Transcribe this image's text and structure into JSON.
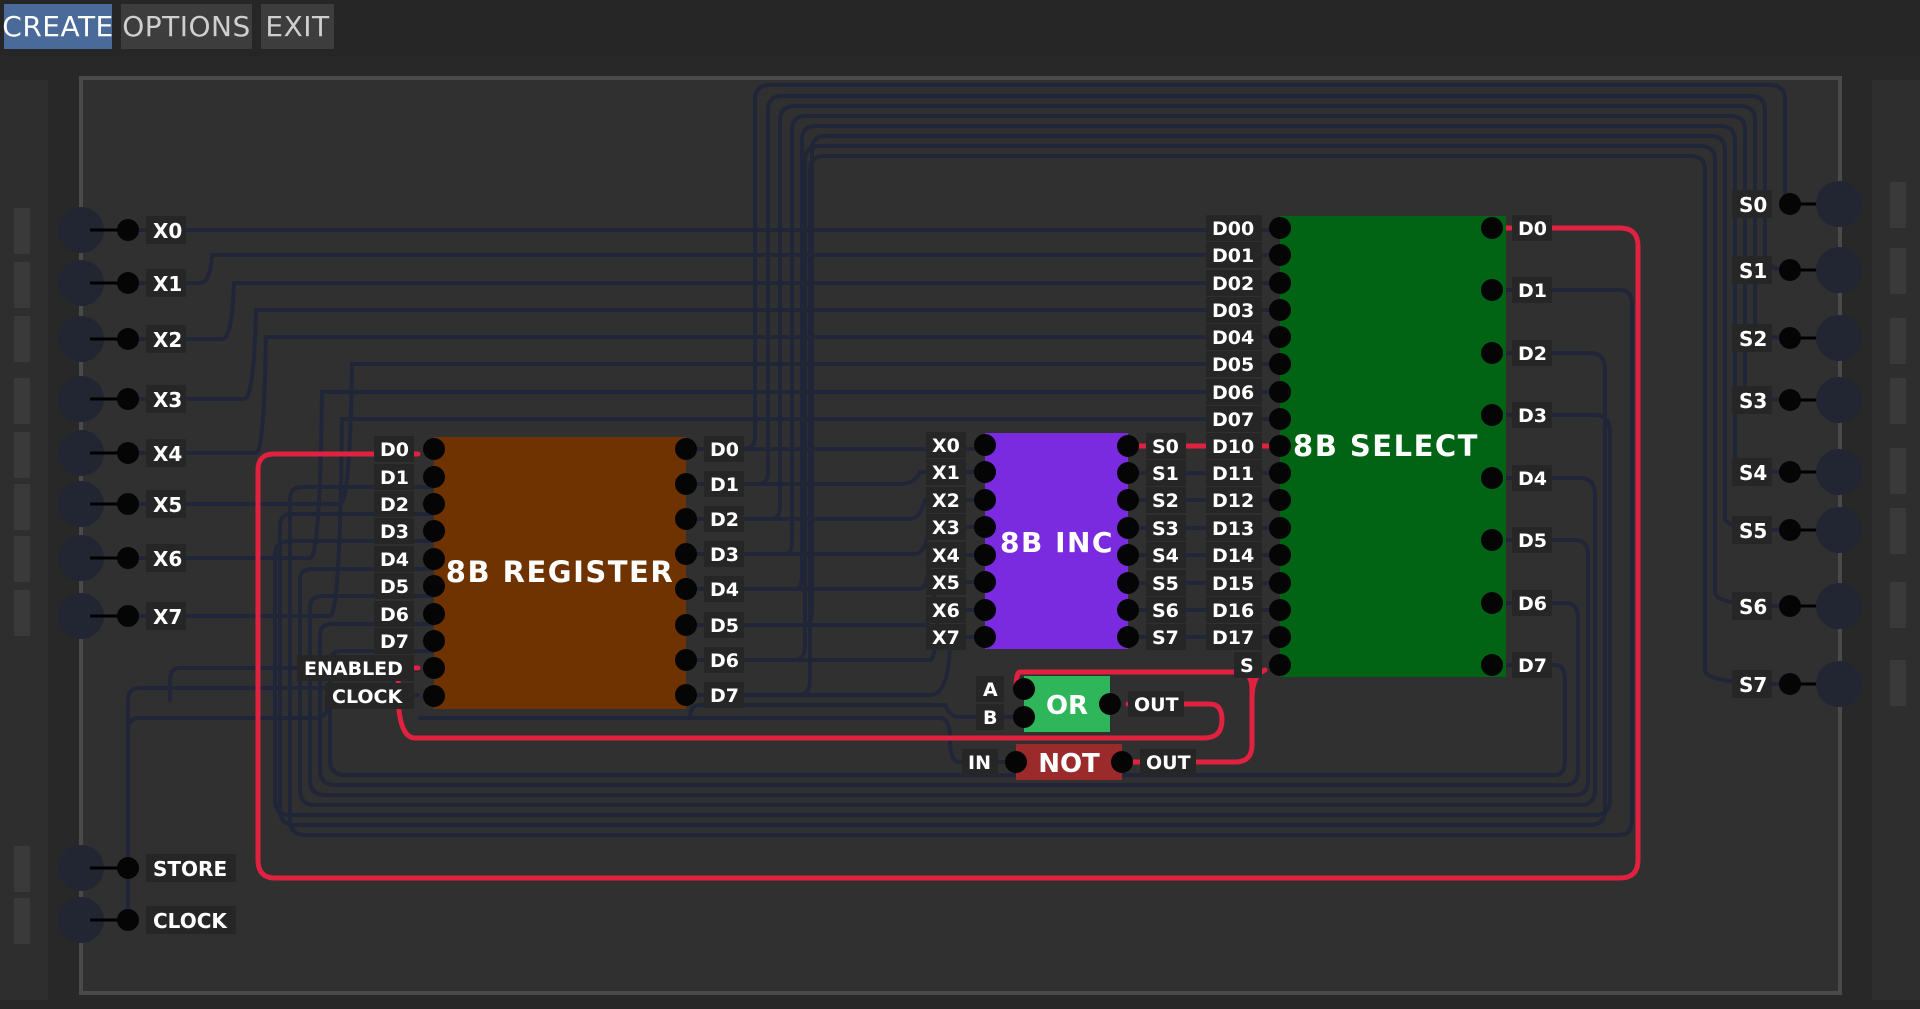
{
  "menu": {
    "create_label": "CREATE",
    "options_label": "OPTIONS",
    "exit_label": "EXIT"
  },
  "inputs": {
    "x0": "X0",
    "x1": "X1",
    "x2": "X2",
    "x3": "X3",
    "x4": "X4",
    "x5": "X5",
    "x6": "X6",
    "x7": "X7",
    "store": "STORE",
    "clock": "CLOCK"
  },
  "outputs": {
    "s0": "S0",
    "s1": "S1",
    "s2": "S2",
    "s3": "S3",
    "s4": "S4",
    "s5": "S5",
    "s6": "S6",
    "s7": "S7"
  },
  "register": {
    "title": "8B REGISTER",
    "in_pins": [
      "D0",
      "D1",
      "D2",
      "D3",
      "D4",
      "D5",
      "D6",
      "D7"
    ],
    "enabled_label": "ENABLED",
    "clock_label": "CLOCK",
    "out_pins": [
      "D0",
      "D1",
      "D2",
      "D3",
      "D4",
      "D5",
      "D6",
      "D7"
    ]
  },
  "inc": {
    "title": "8B INC",
    "in_pins": [
      "X0",
      "X1",
      "X2",
      "X3",
      "X4",
      "X5",
      "X6",
      "X7"
    ],
    "out_pins": [
      "S0",
      "S1",
      "S2",
      "S3",
      "S4",
      "S5",
      "S6",
      "S7"
    ]
  },
  "select": {
    "title": "8B SELECT",
    "in_pins": [
      "D00",
      "D01",
      "D02",
      "D03",
      "D04",
      "D05",
      "D06",
      "D07",
      "D10",
      "D11",
      "D12",
      "D13",
      "D14",
      "D15",
      "D16",
      "D17"
    ],
    "s_label": "S",
    "out_pins": [
      "D0",
      "D1",
      "D2",
      "D3",
      "D4",
      "D5",
      "D6",
      "D7"
    ]
  },
  "or_gate": {
    "title": "OR",
    "a_label": "A",
    "b_label": "B",
    "out_label": "OUT"
  },
  "not_gate": {
    "title": "NOT",
    "in_label": "IN",
    "out_label": "OUT"
  },
  "colors": {
    "register": "#6e3300",
    "inc": "#7a2be0",
    "select": "#006414",
    "or": "#2fb55a",
    "not": "#9b2a2a",
    "wire_off": "#202638",
    "wire_on": "#e0213f",
    "menu_active": "#4a6a99"
  }
}
